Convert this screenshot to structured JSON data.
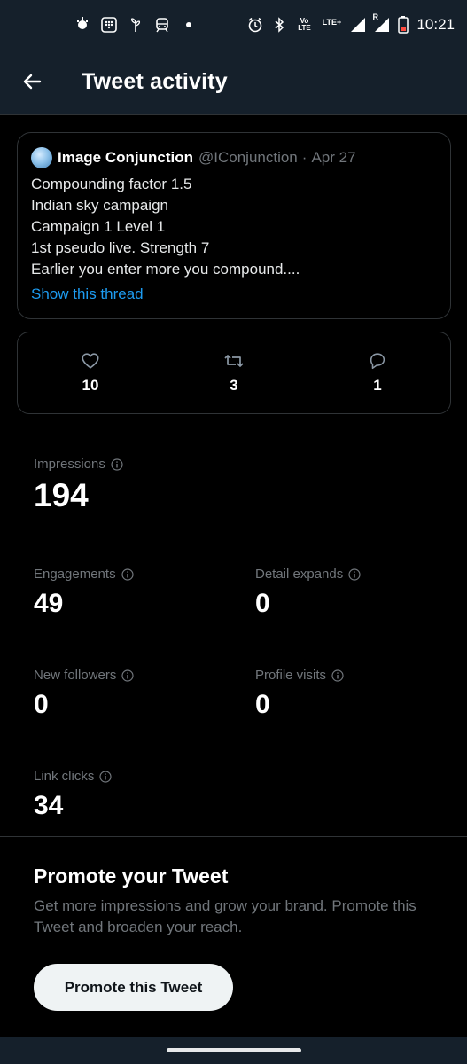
{
  "status_bar": {
    "time": "10:21",
    "left_icons": [
      "app-notification-icon",
      "dialpad-app-icon",
      "sprout-app-icon",
      "train-app-icon",
      "dot-icon"
    ],
    "right_icons": [
      "alarm-icon",
      "bluetooth-icon",
      "volte-icon",
      "lte-icon",
      "signal-icon",
      "signal-roaming-icon",
      "battery-low-icon"
    ],
    "volte_label": "Vo LTE",
    "lte_label": "LTE+",
    "roaming_label": "R",
    "battery_color": "#ff4b3e"
  },
  "header": {
    "title": "Tweet activity",
    "back_icon": "arrow-left-icon"
  },
  "tweet": {
    "name": "Image Conjunction",
    "handle": "@IConjunction",
    "separator": "·",
    "date": "Apr 27",
    "lines": [
      "Compounding factor 1.5",
      "Indian sky campaign",
      "Campaign 1 Level 1",
      "1st pseudo live. Strength 7",
      "Earlier you enter more you compound...."
    ],
    "show_thread": "Show this thread"
  },
  "engagement": {
    "likes": "10",
    "retweets": "3",
    "replies": "1"
  },
  "metrics": {
    "impressions": {
      "label": "Impressions",
      "value": "194"
    },
    "engagements": {
      "label": "Engagements",
      "value": "49"
    },
    "detail_expands": {
      "label": "Detail expands",
      "value": "0"
    },
    "new_followers": {
      "label": "New followers",
      "value": "0"
    },
    "profile_visits": {
      "label": "Profile visits",
      "value": "0"
    },
    "link_clicks": {
      "label": "Link clicks",
      "value": "34"
    }
  },
  "promote": {
    "title": "Promote your Tweet",
    "description": "Get more impressions and grow your brand. Promote this Tweet and broaden your reach.",
    "button": "Promote this Tweet"
  },
  "colors": {
    "accent": "#1d9bf0",
    "muted": "#71767b",
    "header_bg": "#15202b",
    "border": "#2f3336"
  }
}
